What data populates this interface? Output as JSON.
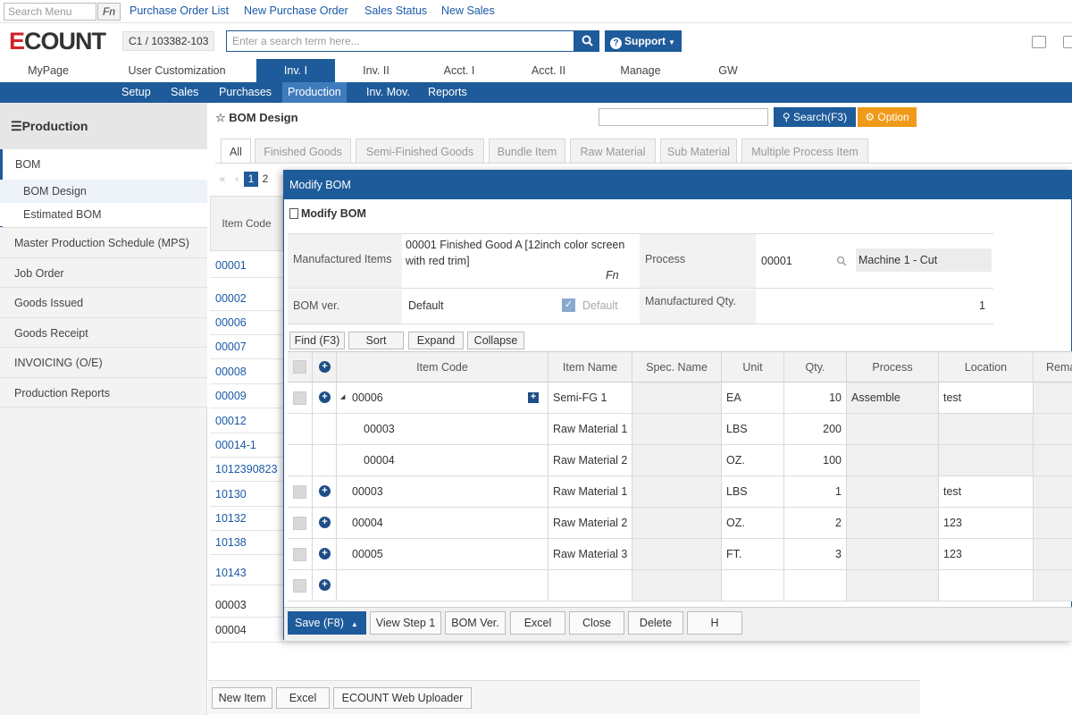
{
  "topbar": {
    "search_placeholder": "Search Menu",
    "fn_label": "Fn",
    "links": [
      "Purchase Order List",
      "New Purchase Order",
      "Sales Status",
      "New Sales"
    ]
  },
  "header": {
    "logo": "ECOUNT",
    "company": "C1 / 103382-103",
    "search_placeholder": "Enter a search term here...",
    "support_label": "Support",
    "search_icon": "search-icon",
    "question_icon": "question-icon"
  },
  "main_tabs": [
    "MyPage",
    "User Customization",
    "Inv. I",
    "Inv. II",
    "Acct. I",
    "Acct. II",
    "Manage",
    "GW"
  ],
  "main_tab_active": "Inv. I",
  "sub_nav": [
    "Setup",
    "Sales",
    "Purchases",
    "Production",
    "Inv. Mov.",
    "Reports"
  ],
  "sub_nav_active": "Production",
  "sidebar": {
    "title": "Production",
    "bom": "BOM",
    "bom_items": [
      "BOM Design",
      "Estimated BOM"
    ],
    "items": [
      "Master Production Schedule (MPS)",
      "Job Order",
      "Goods Issued",
      "Goods Receipt",
      "INVOICING (O/E)",
      "Production Reports"
    ]
  },
  "content": {
    "title": "BOM Design",
    "search_btn": "Search(F3)",
    "option_btn": "Option",
    "tabs": [
      "All",
      "Finished Goods",
      "Semi-Finished Goods",
      "Bundle Item",
      "Raw Material",
      "Sub Material",
      "Multiple Process Item"
    ],
    "pager": {
      "prev": "«",
      "prev2": "‹",
      "pages": [
        "1",
        "2"
      ],
      "current": "1"
    },
    "col_header": "Item Code",
    "rows": [
      "00001",
      "00002",
      "00006",
      "00007",
      "00008",
      "00009",
      "00012",
      "00014-1",
      "1012390823",
      "10130",
      "10132",
      "10138",
      "10143",
      "00003",
      "00004"
    ],
    "footer_buttons": [
      "New Item",
      "Excel",
      "ECOUNT Web Uploader"
    ]
  },
  "modal": {
    "title": "Modify BOM",
    "subtitle": "Modify BOM",
    "manufactured_items_label": "Manufactured Items",
    "manufactured_items_value_1": "00001 Finished Good A [12inch color screen",
    "manufactured_items_value_2": "with red trim]",
    "fn_label": "Fn",
    "process_label": "Process",
    "process_code": "00001",
    "process_name": "Machine 1 - Cut",
    "bom_ver_label": "BOM ver.",
    "bom_ver_value": "Default",
    "default_checkbox_label": "Default",
    "manufactured_qty_label": "Manufactured Qty.",
    "manufactured_qty_value": "1",
    "toolbar": [
      "Find (F3)",
      "Sort",
      "Expand",
      "Collapse"
    ],
    "grid_headers": [
      "Item Code",
      "Item Name",
      "Spec. Name",
      "Unit",
      "Qty.",
      "Process",
      "Location",
      "Rema"
    ],
    "grid_rows": [
      {
        "code": "00006",
        "name": "Semi-FG 1",
        "spec": "",
        "unit": "EA",
        "qty": "10",
        "process": "Assemble",
        "location": "test",
        "level": 0,
        "expandable": true
      },
      {
        "code": "00003",
        "name": "Raw Material 1",
        "spec": "",
        "unit": "LBS",
        "qty": "200",
        "process": "",
        "location": "",
        "level": 1
      },
      {
        "code": "00004",
        "name": "Raw Material 2",
        "spec": "",
        "unit": "OZ.",
        "qty": "100",
        "process": "",
        "location": "",
        "level": 1
      },
      {
        "code": "00003",
        "name": "Raw Material 1",
        "spec": "",
        "unit": "LBS",
        "qty": "1",
        "process": "",
        "location": "test",
        "level": 0
      },
      {
        "code": "00004",
        "name": "Raw Material 2",
        "spec": "",
        "unit": "OZ.",
        "qty": "2",
        "process": "",
        "location": "123",
        "level": 0
      },
      {
        "code": "00005",
        "name": "Raw Material 3",
        "spec": "",
        "unit": "FT.",
        "qty": "3",
        "process": "",
        "location": "123",
        "level": 0
      },
      {
        "code": "",
        "name": "",
        "spec": "",
        "unit": "",
        "qty": "",
        "process": "",
        "location": "",
        "level": 0
      }
    ],
    "footer": {
      "save": "Save (F8)",
      "buttons": [
        "View Step 1",
        "BOM Ver.",
        "Excel",
        "Close",
        "Delete",
        "H"
      ]
    }
  },
  "colors": {
    "primary": "#1e5b9a",
    "option": "#f09a1a",
    "logo_accent": "#d2232a"
  }
}
